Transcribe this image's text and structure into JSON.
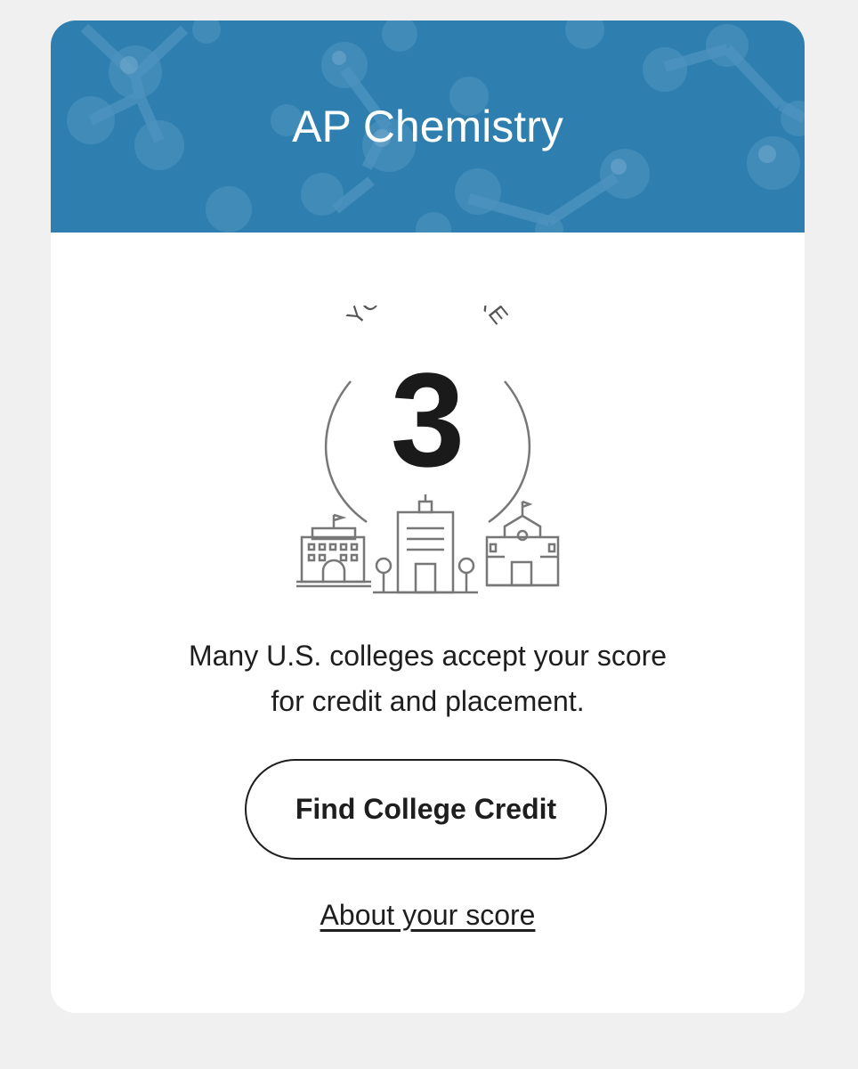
{
  "header": {
    "title": "AP Chemistry",
    "background_color": "#2e7fb0",
    "decoration": "molecule-pattern"
  },
  "score": {
    "caption": "YOUR SCORE",
    "value": "3"
  },
  "illustration": "college-buildings-icon",
  "message": "Many U.S. colleges accept your score for credit and placement.",
  "actions": {
    "primary_label": "Find College Credit",
    "link_label": "About your score"
  }
}
